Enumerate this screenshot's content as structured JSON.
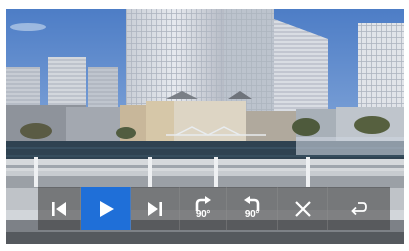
{
  "viewer": {
    "toolbar": {
      "buttons": [
        {
          "id": "previous",
          "icon": "skip-previous-icon",
          "state": "normal"
        },
        {
          "id": "play",
          "icon": "play-icon",
          "state": "active"
        },
        {
          "id": "next",
          "icon": "skip-next-icon",
          "state": "normal"
        },
        {
          "id": "rotate-right",
          "icon": "rotate-clockwise-icon",
          "label": "90°",
          "state": "normal"
        },
        {
          "id": "rotate-left",
          "icon": "rotate-counterclockwise-icon",
          "label": "90°",
          "state": "normal"
        },
        {
          "id": "close",
          "icon": "close-icon",
          "state": "normal"
        },
        {
          "id": "return",
          "icon": "return-arrow-icon",
          "state": "normal"
        }
      ],
      "colors": {
        "bar": "#3a3a3a",
        "active": "#1f6fd8",
        "icon": "#ffffff"
      }
    }
  }
}
